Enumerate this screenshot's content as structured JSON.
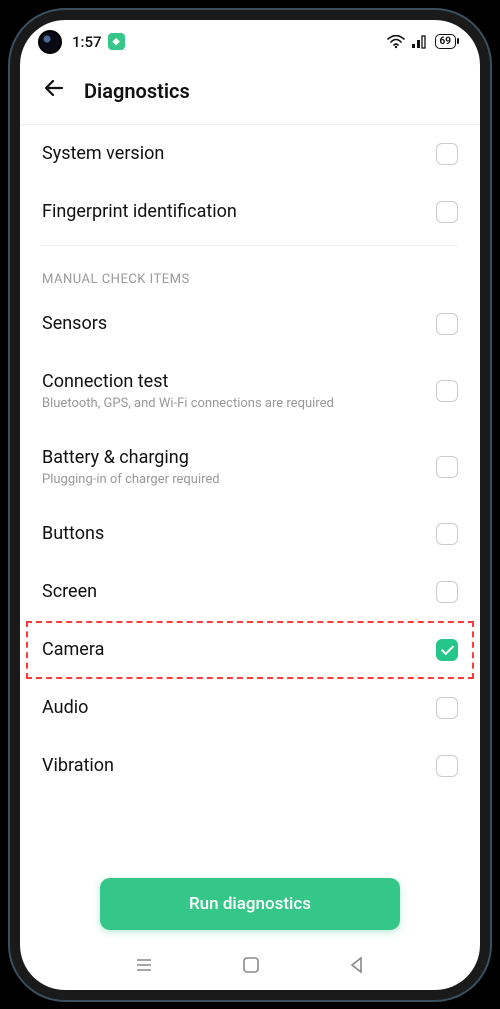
{
  "status": {
    "time": "1:57",
    "battery": "69"
  },
  "header": {
    "title": "Diagnostics"
  },
  "auto_items": [
    {
      "label": "System version",
      "checked": false
    },
    {
      "label": "Fingerprint identification",
      "checked": false
    }
  ],
  "section_header": "MANUAL CHECK ITEMS",
  "manual_items": [
    {
      "label": "Sensors",
      "sub": "",
      "checked": false,
      "highlight": false
    },
    {
      "label": "Connection test",
      "sub": "Bluetooth, GPS, and Wi-Fi connections are required",
      "checked": false,
      "highlight": false
    },
    {
      "label": "Battery & charging",
      "sub": "Plugging-in of charger required",
      "checked": false,
      "highlight": false
    },
    {
      "label": "Buttons",
      "sub": "",
      "checked": false,
      "highlight": false
    },
    {
      "label": "Screen",
      "sub": "",
      "checked": false,
      "highlight": false
    },
    {
      "label": "Camera",
      "sub": "",
      "checked": true,
      "highlight": true
    },
    {
      "label": "Audio",
      "sub": "",
      "checked": false,
      "highlight": false
    },
    {
      "label": "Vibration",
      "sub": "",
      "checked": false,
      "highlight": false
    }
  ],
  "run_button": "Run diagnostics"
}
